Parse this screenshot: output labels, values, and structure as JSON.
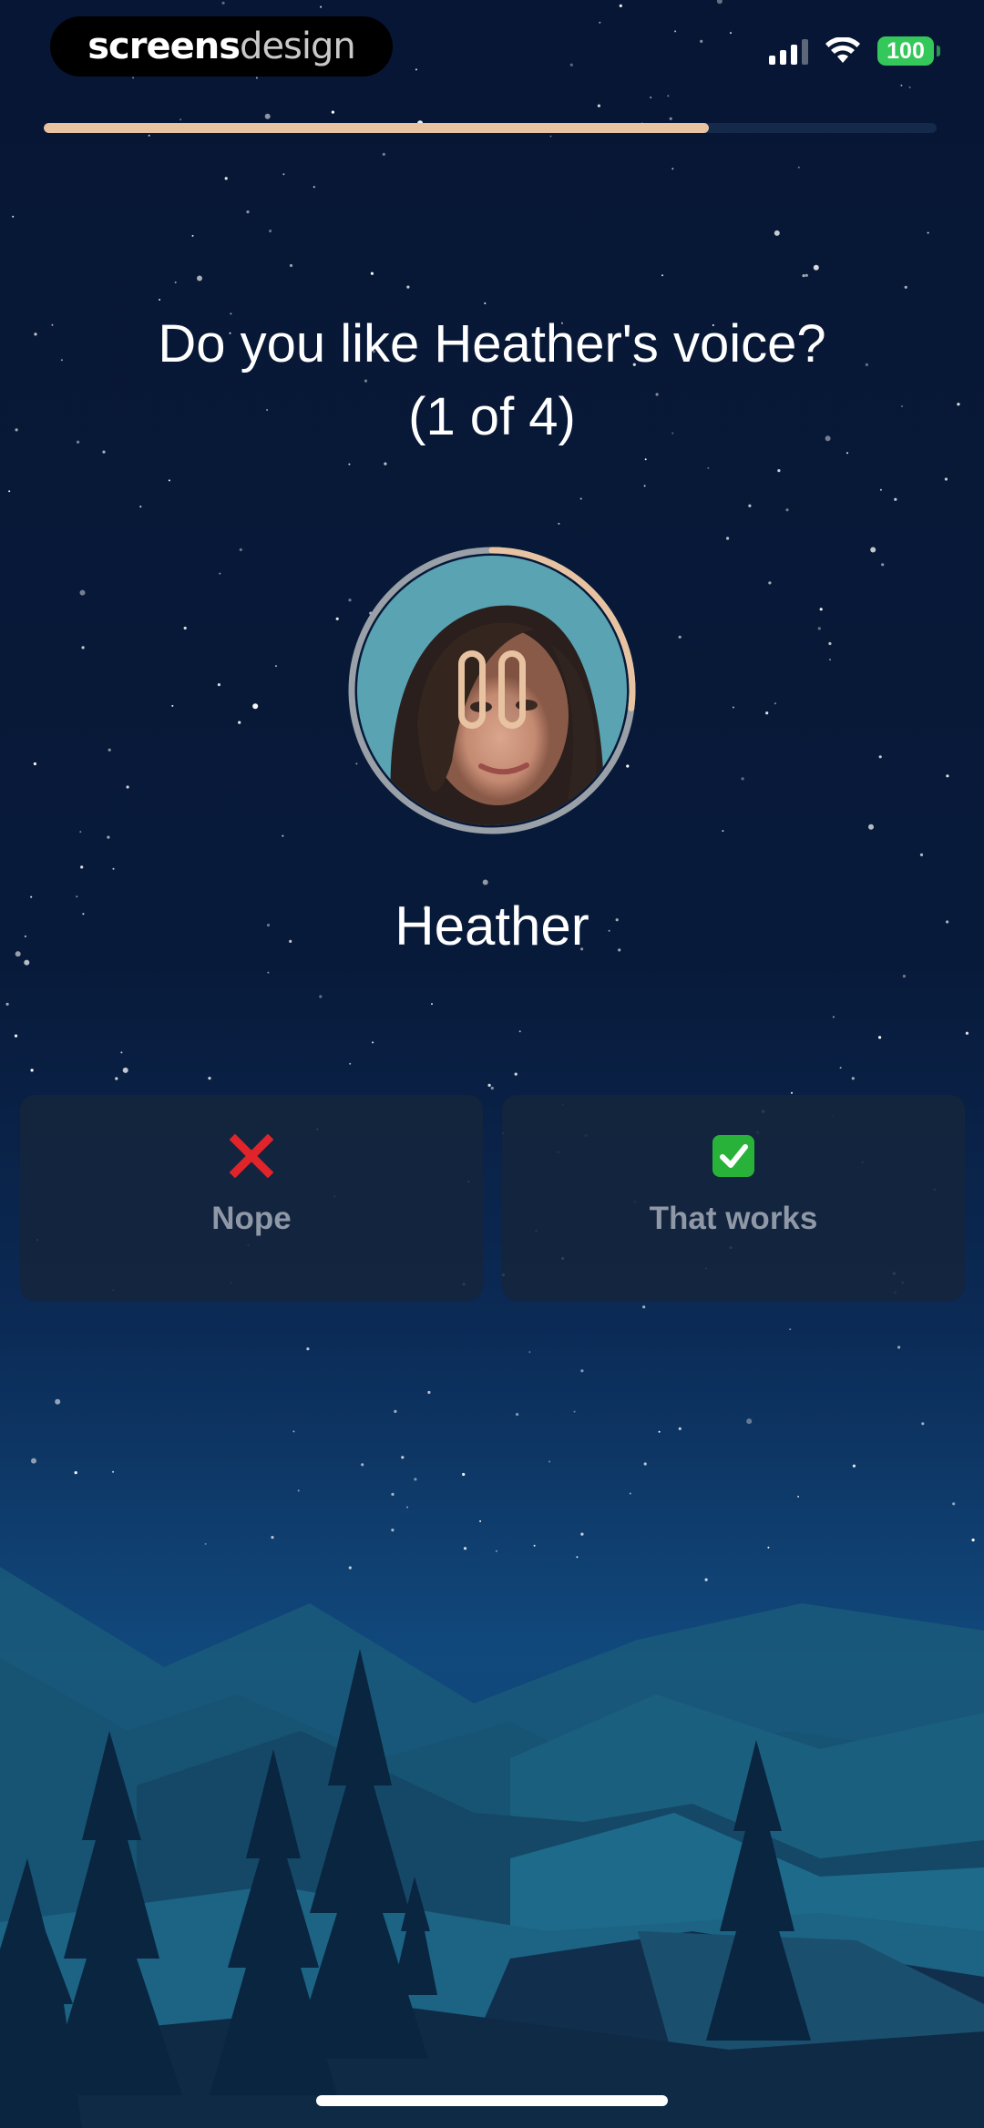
{
  "status_bar": {
    "logo_text_bold": "screens",
    "logo_text_light": "design",
    "battery_level": "100"
  },
  "progress": {
    "fraction": 0.745
  },
  "question": {
    "line1": "Do you like Heather's voice?",
    "line2": "(1 of 4)"
  },
  "voice": {
    "name": "Heather",
    "playback_progress": 0.27,
    "state_icon": "pause-icon"
  },
  "choices": [
    {
      "label": "Nope",
      "icon": "cross-mark-icon",
      "color": "#e0242a"
    },
    {
      "label": "That works",
      "icon": "check-mark-icon",
      "color": "#29b23a"
    }
  ],
  "colors": {
    "accent": "#e8c3a2",
    "background_top": "#061430",
    "background_bottom": "#0d3a66"
  }
}
